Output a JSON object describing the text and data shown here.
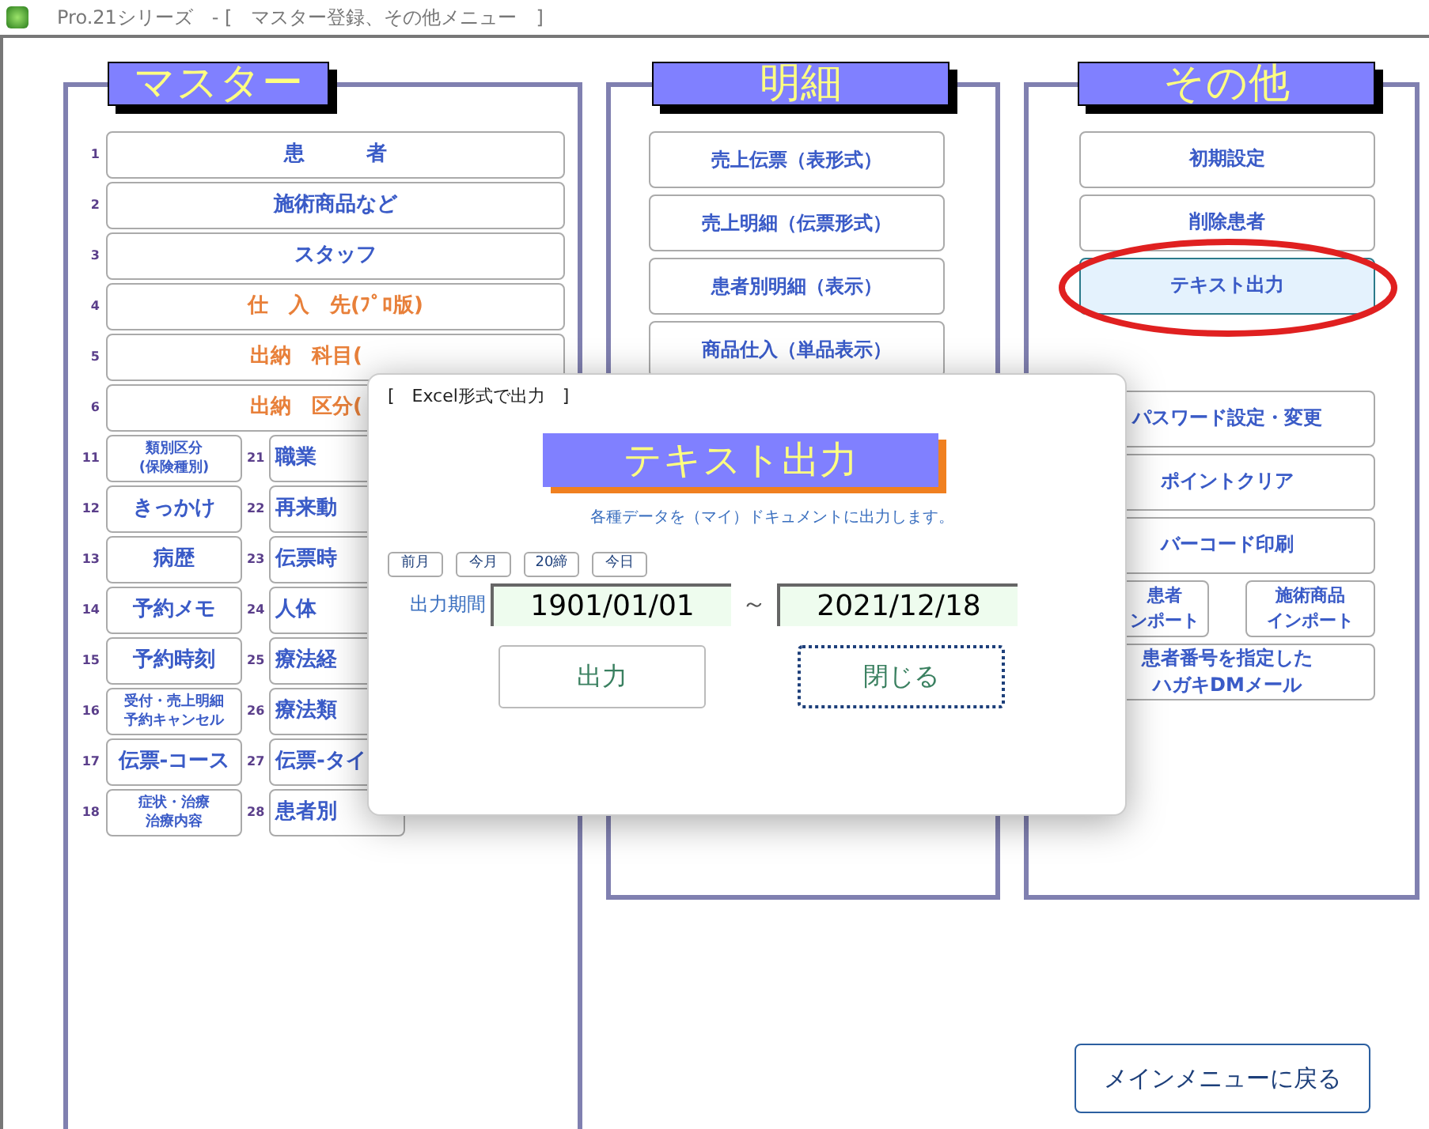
{
  "window": {
    "title": "Pro.21シリーズ　- [　マスター登録、その他メニュー　]"
  },
  "master": {
    "title": "マスター",
    "buttons": [
      {
        "number": "1",
        "label": "患　　　者",
        "color": "#3a5bc7",
        "cut": false
      },
      {
        "number": "2",
        "label": "施術商品など",
        "color": "#3a5bc7",
        "cut": false
      },
      {
        "number": "3",
        "label": "スタッフ",
        "color": "#3a5bc7",
        "cut": false
      },
      {
        "number": "4",
        "label": "仕　入　先(ﾌﾟﾛ版)",
        "color": "#e8803a",
        "cut": false
      },
      {
        "number": "5",
        "label": "出納　科目(",
        "color": "#e8803a",
        "cut": true
      },
      {
        "number": "6",
        "label": "出納　区分(",
        "color": "#e8803a",
        "cut": true
      }
    ],
    "small_buttons": [
      {
        "number": "11",
        "lines": [
          "類別区分",
          "(保険種別)"
        ],
        "kind": "small",
        "cut": false
      },
      {
        "number": "21",
        "lines": [
          "職業"
        ],
        "kind": "large",
        "cut": true
      },
      {
        "number": "12",
        "lines": [
          "きっかけ"
        ],
        "kind": "large",
        "cut": false
      },
      {
        "number": "22",
        "lines": [
          "再来動"
        ],
        "kind": "large",
        "cut": true
      },
      {
        "number": "13",
        "lines": [
          "病歴"
        ],
        "kind": "large",
        "cut": false
      },
      {
        "number": "23",
        "lines": [
          "伝票時"
        ],
        "kind": "large",
        "cut": true
      },
      {
        "number": "14",
        "lines": [
          "予約メモ"
        ],
        "kind": "large",
        "cut": false
      },
      {
        "number": "24",
        "lines": [
          "人体"
        ],
        "kind": "large",
        "cut": true
      },
      {
        "number": "15",
        "lines": [
          "予約時刻"
        ],
        "kind": "large",
        "cut": false
      },
      {
        "number": "25",
        "lines": [
          "療法経"
        ],
        "kind": "large",
        "cut": true
      },
      {
        "number": "16",
        "lines": [
          "受付・売上明細",
          "予約キャンセル"
        ],
        "kind": "small",
        "cut": false
      },
      {
        "number": "26",
        "lines": [
          "療法類"
        ],
        "kind": "large",
        "cut": true
      },
      {
        "number": "17",
        "lines": [
          "伝票-コース"
        ],
        "kind": "large",
        "cut": false
      },
      {
        "number": "27",
        "lines": [
          "伝票-タイ"
        ],
        "kind": "large",
        "cut": true
      },
      {
        "number": "18",
        "lines": [
          "症状・治療",
          "治療内容"
        ],
        "kind": "small",
        "cut": false
      },
      {
        "number": "28",
        "lines": [
          "患者別"
        ],
        "kind": "large",
        "cut": true
      }
    ]
  },
  "details": {
    "title": "明細",
    "buttons": [
      {
        "label": "売上伝票（表形式）"
      },
      {
        "label": "売上明細（伝票形式）"
      },
      {
        "label": "患者別明細（表示）"
      },
      {
        "label": "商品仕入（単品表示）"
      }
    ]
  },
  "other": {
    "title": "その他",
    "buttons": [
      {
        "lines": [
          "初期設定"
        ],
        "kind": "full",
        "selected": false
      },
      {
        "lines": [
          "削除患者"
        ],
        "kind": "full",
        "selected": false
      },
      {
        "lines": [
          "テキスト出力"
        ],
        "kind": "full",
        "selected": true
      },
      {
        "lines": [
          "パスワード設定・変更"
        ],
        "kind": "full",
        "selected": false
      },
      {
        "lines": [
          "ポイントクリア"
        ],
        "kind": "full",
        "selected": false
      },
      {
        "lines": [
          "バーコード印刷"
        ],
        "kind": "full",
        "selected": false
      },
      {
        "lines": [
          "患者",
          "ンポート"
        ],
        "kind": "half_cut",
        "selected": false
      },
      {
        "lines": [
          "施術商品",
          "インポート"
        ],
        "kind": "half",
        "selected": false
      },
      {
        "lines": [
          "患者番号を指定した",
          "ハガキDMメール"
        ],
        "kind": "full",
        "selected": false
      }
    ]
  },
  "main_menu_button": "メインメニューに戻る",
  "dialog": {
    "title": "[　Excel形式で出力　]",
    "heading": "テキスト出力",
    "description": "各種データを（マイ）ドキュメントに出力します。",
    "quick_buttons": [
      "前月",
      "今月",
      "20締",
      "今日"
    ],
    "period_label": "出力期間",
    "from": "1901/01/01",
    "separator": "～",
    "to": "2021/12/18",
    "buttons": [
      {
        "label": "出力",
        "focused": false
      },
      {
        "label": "閉じる",
        "focused": true
      }
    ]
  }
}
